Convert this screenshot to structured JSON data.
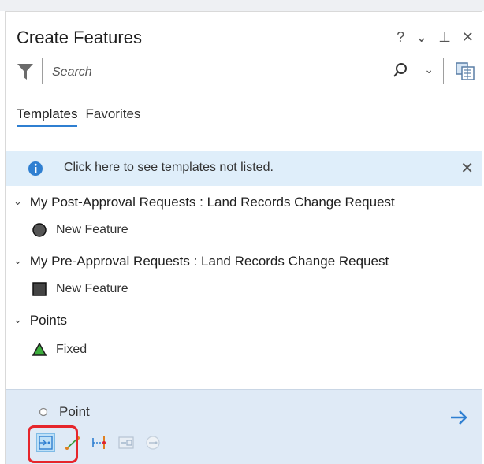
{
  "panel": {
    "title": "Create Features",
    "tools": {
      "help": "?",
      "options": "⌄",
      "pin": "⊥",
      "close": "✕"
    }
  },
  "search": {
    "placeholder": "Search",
    "value": ""
  },
  "tabs": [
    {
      "label": "Templates",
      "active": true
    },
    {
      "label": "Favorites",
      "active": false
    }
  ],
  "info_bar": {
    "text": "Click here to see templates not listed.",
    "icon": "info-icon"
  },
  "groups": [
    {
      "name": "My Post-Approval Requests : Land Records Change Request",
      "items": [
        {
          "label": "New Feature",
          "icon": "circle-symbol-icon"
        }
      ]
    },
    {
      "name": "My Pre-Approval Requests : Land Records Change Request",
      "items": [
        {
          "label": "New Feature",
          "icon": "square-symbol-icon"
        }
      ]
    },
    {
      "name": "Points",
      "items": [
        {
          "label": "Fixed",
          "icon": "triangle-symbol-icon"
        }
      ]
    }
  ],
  "selected_template": {
    "label": "Point",
    "tools": [
      "point-tool-icon",
      "line-tool-icon",
      "distance-direction-tool-icon",
      "xy-entry-tool-icon",
      "point-at-end-tool-icon"
    ],
    "active_tool": "point-tool-icon"
  },
  "colors": {
    "accent": "#2f7fd1",
    "info_background": "#dfeefa",
    "selected_background": "#dfeaf6",
    "highlight": "#e6262c"
  }
}
